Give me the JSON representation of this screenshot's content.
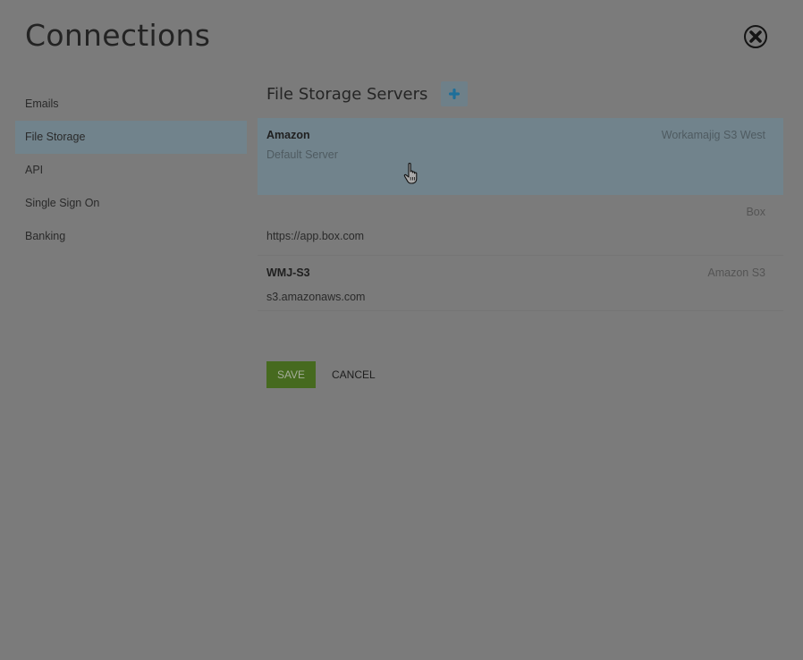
{
  "dialog": {
    "title": "Connections",
    "close_icon": "close-circle-icon"
  },
  "sidebar": {
    "items": [
      {
        "label": "Emails",
        "active": false
      },
      {
        "label": "File Storage",
        "active": true
      },
      {
        "label": "API",
        "active": false
      },
      {
        "label": "Single Sign On",
        "active": false
      },
      {
        "label": "Banking",
        "active": false
      }
    ]
  },
  "main": {
    "section_title": "File Storage Servers",
    "add_icon": "plus-icon",
    "servers": [
      {
        "name": "Amazon",
        "type": "Workamajig S3 West",
        "subtitle": "Default Server",
        "selected": true
      },
      {
        "name": "",
        "type": "Box",
        "subtitle": "https://app.box.com",
        "selected": false
      },
      {
        "name": "WMJ-S3",
        "type": "Amazon S3",
        "subtitle": "s3.amazonaws.com",
        "selected": false
      }
    ]
  },
  "actions": {
    "save_label": "SAVE",
    "cancel_label": "CANCEL"
  },
  "colors": {
    "overlay_bg": "#7b7b7b",
    "selected_bg": "#71838c",
    "save_bg": "#466a1f",
    "add_icon": "#1e6f9a"
  },
  "cursor_icon": "hand-pointer-icon"
}
